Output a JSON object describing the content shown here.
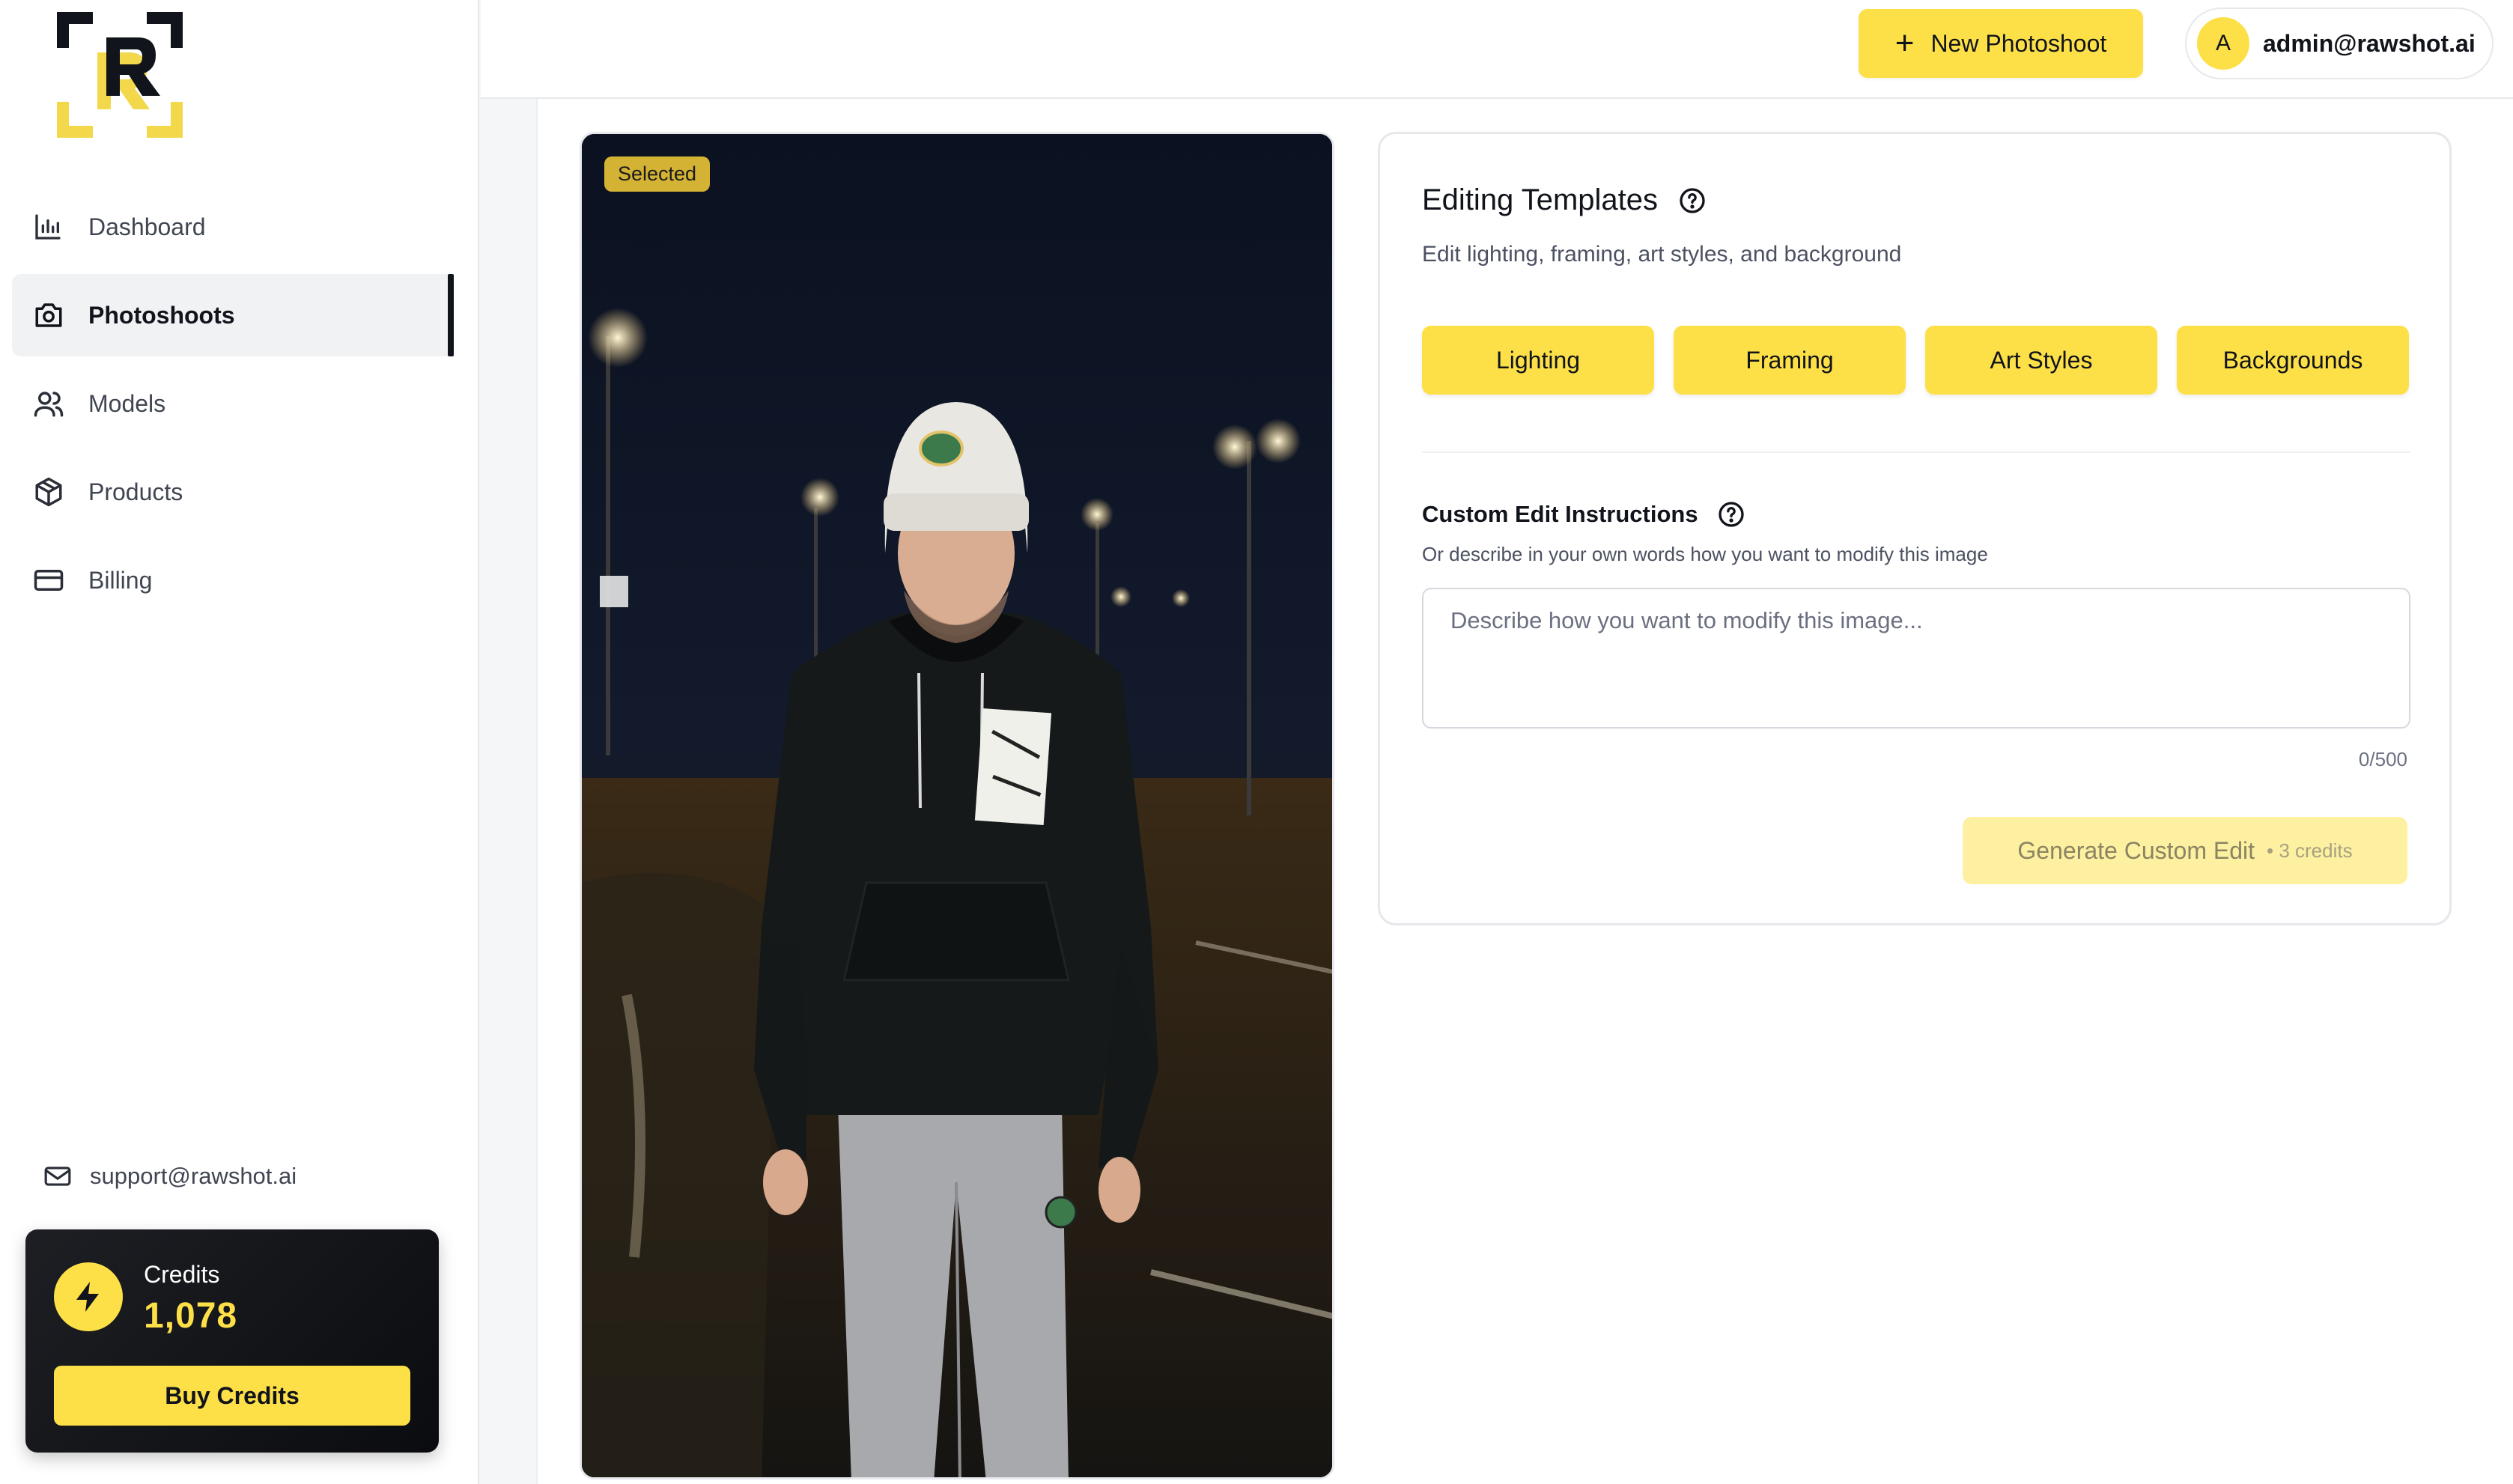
{
  "sidebar": {
    "nav": [
      {
        "label": "Dashboard",
        "icon": "bar-chart-icon",
        "active": false
      },
      {
        "label": "Photoshoots",
        "icon": "camera-icon",
        "active": true
      },
      {
        "label": "Models",
        "icon": "users-icon",
        "active": false
      },
      {
        "label": "Products",
        "icon": "box-icon",
        "active": false
      },
      {
        "label": "Billing",
        "icon": "credit-card-icon",
        "active": false
      }
    ],
    "support_email": "support@rawshot.ai",
    "credits": {
      "label": "Credits",
      "value": "1,078",
      "buy_label": "Buy Credits"
    }
  },
  "header": {
    "new_photoshoot_label": "New Photoshoot",
    "user": {
      "initial": "A",
      "email": "admin@rawshot.ai"
    }
  },
  "photo": {
    "badge": "Selected"
  },
  "editing": {
    "title": "Editing Templates",
    "subtitle": "Edit lighting, framing, art styles, and background",
    "templates": [
      "Lighting",
      "Framing",
      "Art Styles",
      "Backgrounds"
    ],
    "custom": {
      "title": "Custom Edit Instructions",
      "subtitle": "Or describe in your own words how you want to modify this image",
      "placeholder": "Describe how you want to modify this image...",
      "counter": "0/500",
      "generate_label": "Generate Custom Edit",
      "generate_cost": "• 3 credits"
    }
  },
  "colors": {
    "accent": "#fde047",
    "badge": "#d4b234",
    "dark": "#11141b"
  }
}
